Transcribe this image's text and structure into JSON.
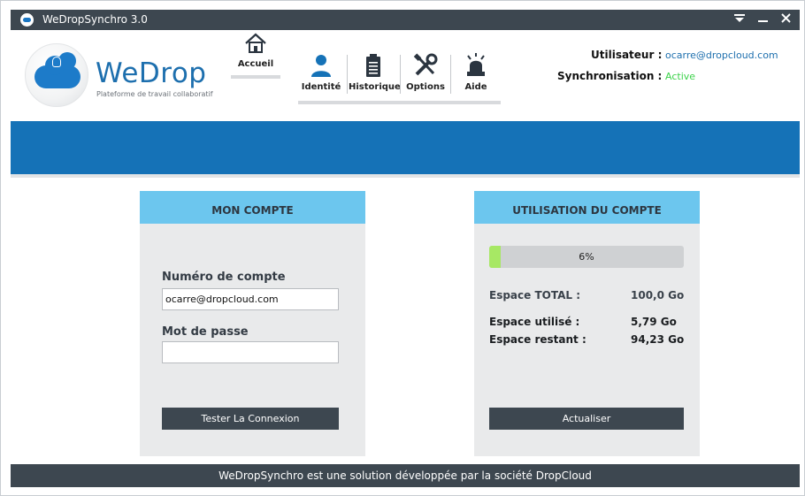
{
  "window": {
    "title": "WeDropSynchro 3.0"
  },
  "brand": {
    "name": "WeDrop",
    "tagline": "Plateforme de travail collaboratif"
  },
  "nav": {
    "home": {
      "label": "Accueil",
      "icon": "home-icon"
    },
    "items": [
      {
        "label": "Identité",
        "icon": "user-icon"
      },
      {
        "label": "Historique",
        "icon": "clipboard-icon"
      },
      {
        "label": "Options",
        "icon": "tools-icon"
      },
      {
        "label": "Aide",
        "icon": "siren-icon"
      }
    ]
  },
  "user": {
    "user_label": "Utilisateur :",
    "user_value": "ocarre@dropcloud.com",
    "sync_label": "Synchronisation :",
    "sync_value": "Active"
  },
  "account_panel": {
    "title": "MON COMPTE",
    "account_label": "Numéro de compte",
    "account_value": "ocarre@dropcloud.com",
    "password_label": "Mot de passe",
    "password_value": "",
    "test_button": "Tester La Connexion"
  },
  "usage_panel": {
    "title": "UTILISATION DU COMPTE",
    "progress_percent": 6,
    "progress_text": "6%",
    "total_label": "Espace TOTAL :",
    "total_value": "100,0 Go",
    "used_label": "Espace utilisé :",
    "used_value": "5,79 Go",
    "remaining_label": "Espace restant :",
    "remaining_value": "94,23 Go",
    "refresh_button": "Actualiser"
  },
  "footer": {
    "text": "WeDropSynchro est une solution développée par la société DropCloud"
  },
  "colors": {
    "titlebar": "#3d4750",
    "accent_blue": "#1572b7",
    "panel_header": "#6cc6ee",
    "link_blue": "#1d6fae",
    "status_active": "#3cd24a",
    "progress_fill": "#a7e864"
  }
}
